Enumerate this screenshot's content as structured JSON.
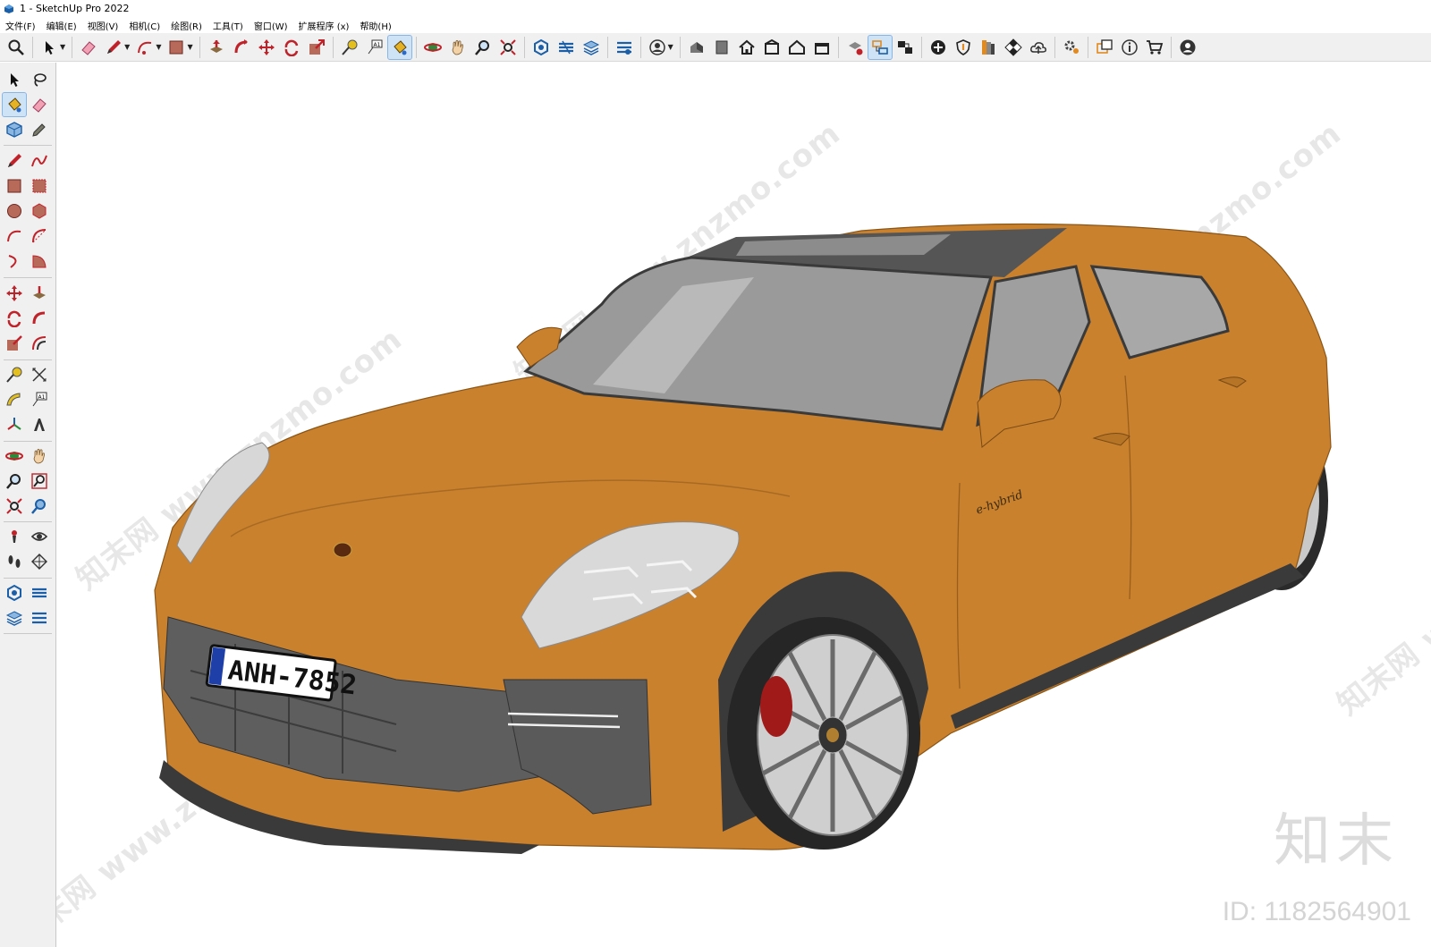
{
  "window": {
    "title": "1 - SketchUp Pro 2022"
  },
  "menu": [
    "文件(F)",
    "编辑(E)",
    "视图(V)",
    "相机(C)",
    "绘图(R)",
    "工具(T)",
    "窗口(W)",
    "扩展程序 (x)",
    "帮助(H)"
  ],
  "model": {
    "license_plate": "ANH-7852",
    "side_badge": "e-hybrid"
  },
  "watermark": {
    "text": "知末网 www.znzmo.com",
    "brand": "知末",
    "id": "ID: 1182564901"
  },
  "colors": {
    "car_body": "#C9812E",
    "toolbar": "#F0F0F0",
    "active_tool": "#CFE3F7"
  }
}
